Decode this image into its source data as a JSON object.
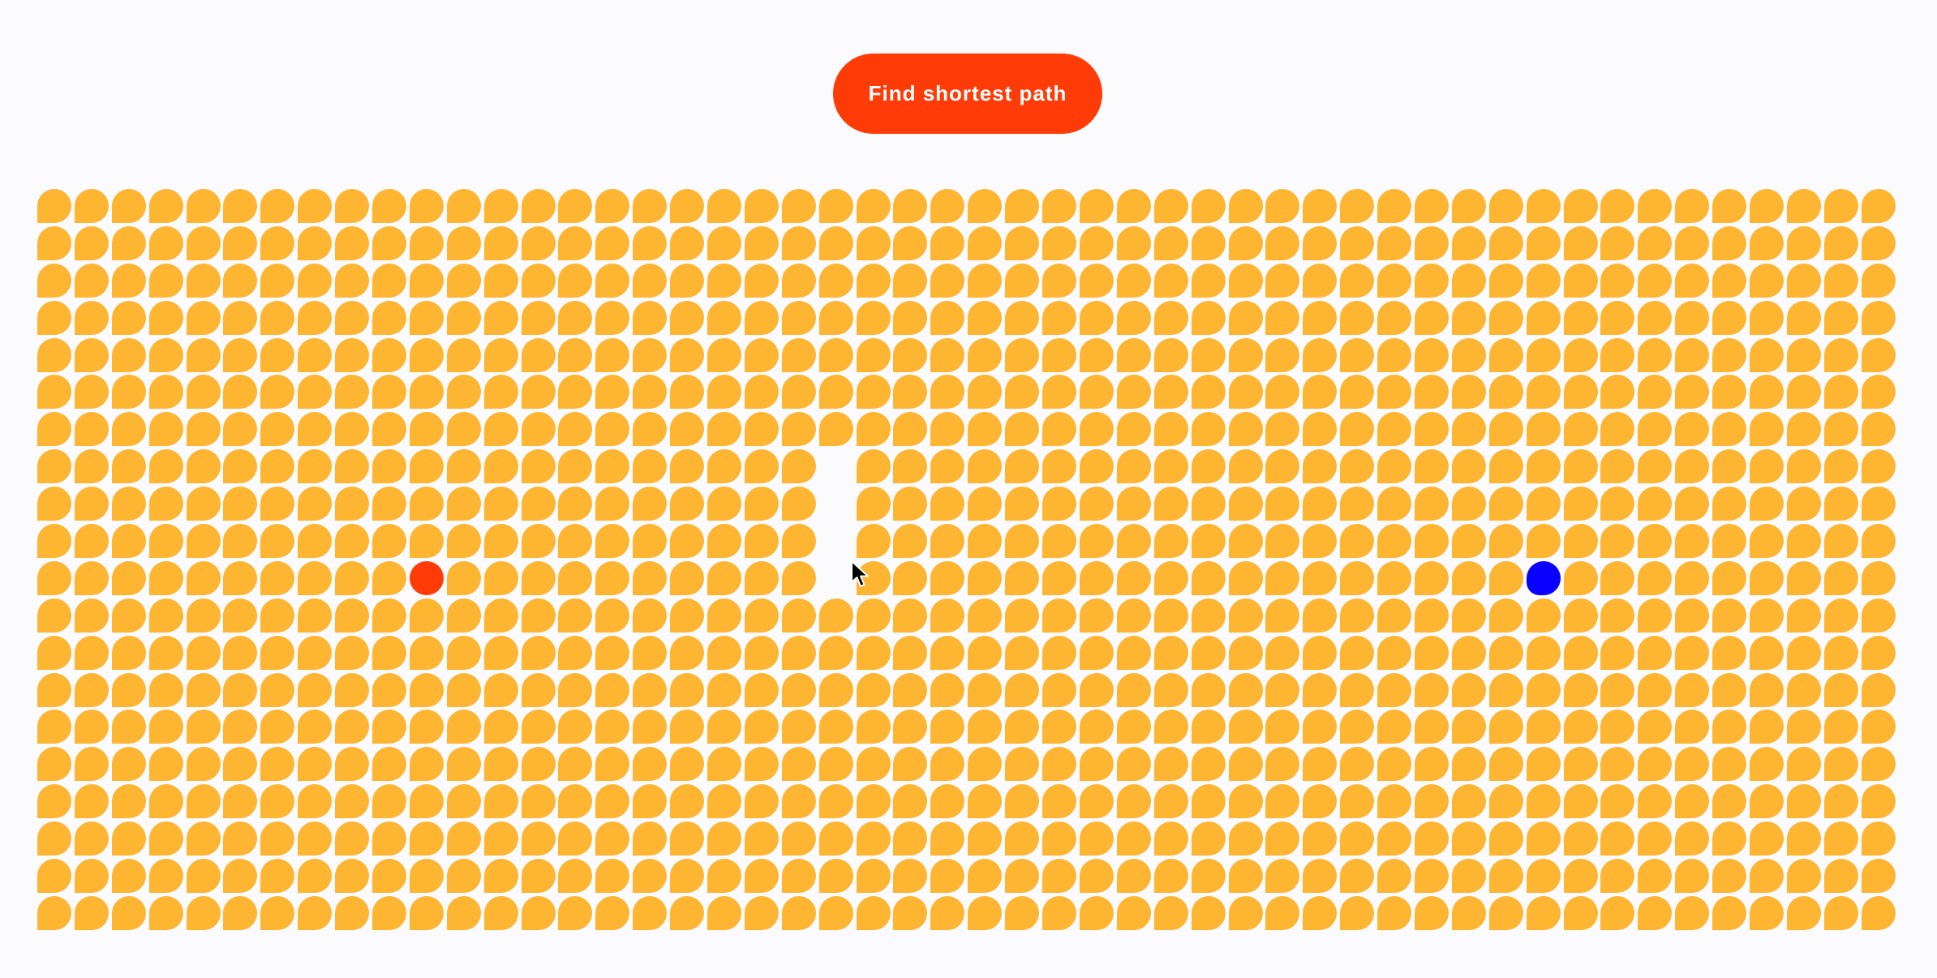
{
  "button": {
    "label": "Find shortest path"
  },
  "grid": {
    "rows": 20,
    "cols": 50,
    "start": {
      "row": 10,
      "col": 10
    },
    "end": {
      "row": 10,
      "col": 40
    },
    "walls": [
      {
        "row": 7,
        "col": 21
      },
      {
        "row": 8,
        "col": 21
      },
      {
        "row": 9,
        "col": 21
      },
      {
        "row": 10,
        "col": 21
      }
    ]
  },
  "colors": {
    "background": "#fbfbfd",
    "button": "#ff3b08",
    "cell": "#fdb532",
    "start": "#ff3b08",
    "end": "#0a00ff",
    "wall": "#fbfbfd"
  },
  "icons": {
    "cursor": "mouse-pointer-icon"
  }
}
